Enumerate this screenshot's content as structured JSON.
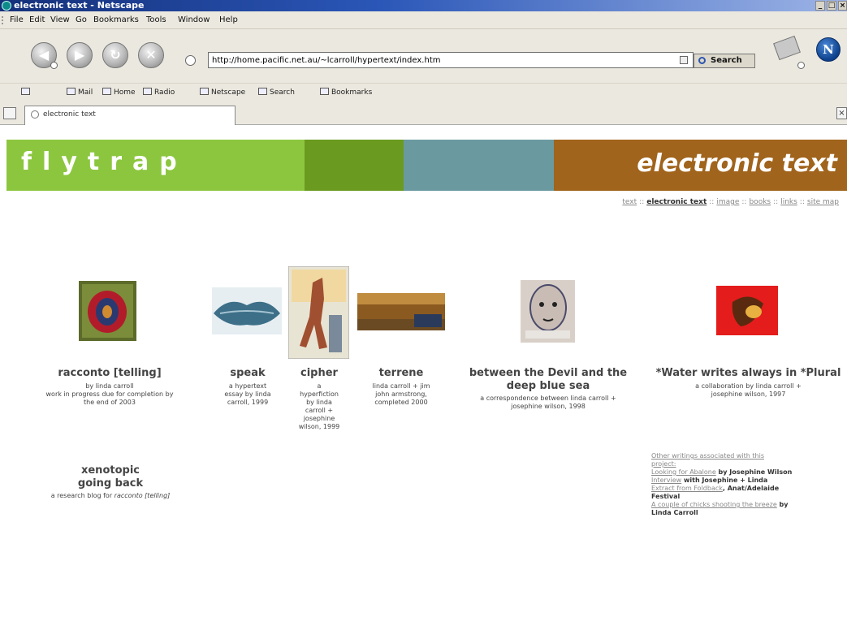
{
  "window": {
    "title": "electronic text - Netscape",
    "min_label": "_",
    "max_label": "□",
    "close_label": "×"
  },
  "menu": [
    "File",
    "Edit",
    "View",
    "Go",
    "Bookmarks",
    "Tools",
    "Window",
    "Help"
  ],
  "navbar": {
    "url": "http://home.pacific.net.au/~lcarroll/hypertext/index.htm",
    "search_label": "Search",
    "netscape_letter": "N"
  },
  "personal_toolbar": [
    "Mail",
    "Home",
    "Radio",
    "Netscape",
    "Search",
    "Bookmarks"
  ],
  "tab": {
    "label": "electronic text",
    "close_label": "×"
  },
  "banner": {
    "site": "flytrap",
    "section": "electronic text",
    "colors": [
      "#8cc63f",
      "#6a9a1f",
      "#6a9aa0",
      "#a0641c"
    ]
  },
  "topnav": {
    "items": [
      "text",
      "electronic text",
      "image",
      "books",
      "links",
      "site map"
    ],
    "current": "electronic text",
    "separator": "::"
  },
  "works": [
    {
      "title": "racconto [telling]",
      "desc1": "by linda carroll",
      "desc2": "work in progress due for completion by",
      "desc3": "the end of 2003"
    },
    {
      "title": "speak",
      "desc1": "a hypertext",
      "desc2": "essay by linda",
      "desc3": "carroll, 1999"
    },
    {
      "title": "cipher",
      "desc1": "a",
      "desc2": "hyperfiction",
      "desc3": "by linda",
      "desc4": "carroll +",
      "desc5": "josephine",
      "desc6": "wilson, 1999"
    },
    {
      "title": "terrene",
      "desc1": "linda carroll + jim",
      "desc2": "john armstrong,",
      "desc3": "completed 2000"
    },
    {
      "title1": "between the Devil and the",
      "title2": "deep blue sea",
      "desc1": "a correspondence between linda carroll +",
      "desc2": "josephine wilson, 1998"
    },
    {
      "title": "*Water writes always in *Plural",
      "desc1": "a collaboration by linda carroll +",
      "desc2": "josephine wilson, 1997"
    }
  ],
  "xenotopic": {
    "title1": "xenotopic",
    "title2": "going back",
    "desc_prefix": "a research blog for ",
    "desc_italic": "racconto [telling]"
  },
  "related": {
    "heading1": "Other writings associated with this",
    "heading2": "project:",
    "l1_link": "Looking for Abalone",
    "l1_rest": " by Josephine Wilson",
    "l2_link": "Interview",
    "l2_rest": " with Josephine + Linda",
    "l3_link": "Extract from Foldback",
    "l3_rest": ", Anat/Adelaide",
    "l3_rest2": "Festival",
    "l4_link": "A couple of chicks shooting the breeze",
    "l4_rest": " by",
    "l4_rest2": "Linda Carroll"
  }
}
